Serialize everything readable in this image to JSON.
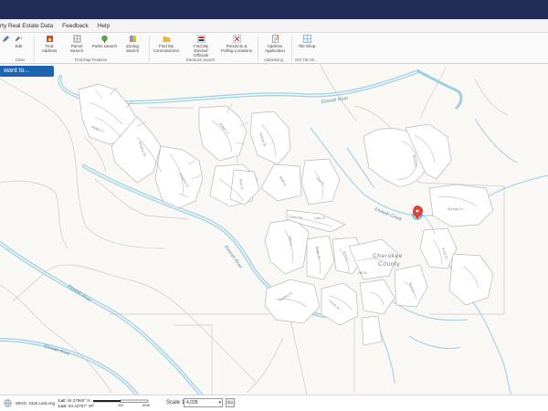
{
  "menubar": {
    "items": [
      "rty Real Estate Data",
      "Feedback",
      "Help"
    ]
  },
  "ribbon": {
    "buttons": {
      "edit": "Edit",
      "find_address": "Find Address",
      "parcel_search": "Parcel Search",
      "parks_search": "Parks Search",
      "zoning_search": "Zoning Search",
      "find_commissioner": "Find My Commissioner",
      "find_elected": "Find My Elected Officials",
      "precincts": "Precincts & Polling Locations",
      "address_app": "Address Application",
      "tile_shop": "Tile Shop"
    },
    "groups": {
      "clear": "Clear",
      "find_map_features": "Find Map Features",
      "elections_search": "Elections Search",
      "addressing": "Addressing",
      "gis_tile": "GIS Tile Sh..."
    }
  },
  "iwant": {
    "label": "want to..."
  },
  "map": {
    "labels": {
      "river_top": "Etowah River",
      "river_mid": "Etowah River",
      "river_left": "Etowah River",
      "river_bottom": "Etowah River",
      "creek": "Etowah Creek",
      "county": "Cherokee",
      "county2": "County",
      "s1": "Ridge Ct",
      "s2": "Estates Dr",
      "s3": "Shadow Ct",
      "s4": "Ridge Ln",
      "s5": "Hollow Dr",
      "s6": "Pine Ct",
      "s7": "Bluff Ln",
      "s8": "Fox Ct",
      "s9": "Estate Dr",
      "s10": "Lake Ct",
      "s11": "Oak Ct",
      "s12": "Ridge Dr",
      "s13": "Elm Ct",
      "s14": "Hill Dr",
      "s15": "Estates Ct",
      "s16": "Creek Dr",
      "s17": "Run Ln",
      "s18": "Bend Dr",
      "s19": "Springs Dr",
      "s20": "Knoll Ct"
    }
  },
  "status": {
    "wkid": "WKID: 4326 Lat/Long",
    "lat_label": "Lat:",
    "lat_value": "34.27960° N",
    "lon_label": "Lon:",
    "lon_value": "84.42757° W",
    "scale_ticks": [
      "0",
      "300",
      "600ft"
    ],
    "scale_label": "Scale 1:",
    "scale_value": "4,028",
    "go": "Go"
  },
  "colors": {
    "top_band": "#202d57",
    "water": "#9fcfe0",
    "accent": "#1e63b0",
    "marker": "#d9453c"
  }
}
